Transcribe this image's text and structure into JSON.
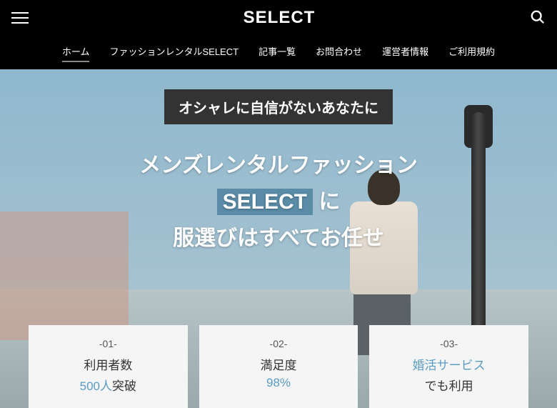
{
  "header": {
    "logo": "SELECT"
  },
  "nav": {
    "items": [
      {
        "label": "ホーム",
        "active": true
      },
      {
        "label": "ファッションレンタルSELECT"
      },
      {
        "label": "記事一覧"
      },
      {
        "label": "お問合わせ"
      },
      {
        "label": "運営者情報"
      },
      {
        "label": "ご利用規約"
      }
    ]
  },
  "hero": {
    "tagline": "オシャレに自信がないあなたに",
    "line1": "メンズレンタルファッション",
    "highlight": "SELECT",
    "line2_suffix": " に",
    "line3": "服選びはすべてお任せ"
  },
  "cards": [
    {
      "num": "-01-",
      "label": "利用者数",
      "value": "500人",
      "suffix": "突破"
    },
    {
      "num": "-02-",
      "label": "満足度",
      "value": "98%",
      "suffix": ""
    },
    {
      "num": "-03-",
      "label_accent": "婚活サービス",
      "value_plain": "でも利用"
    }
  ]
}
